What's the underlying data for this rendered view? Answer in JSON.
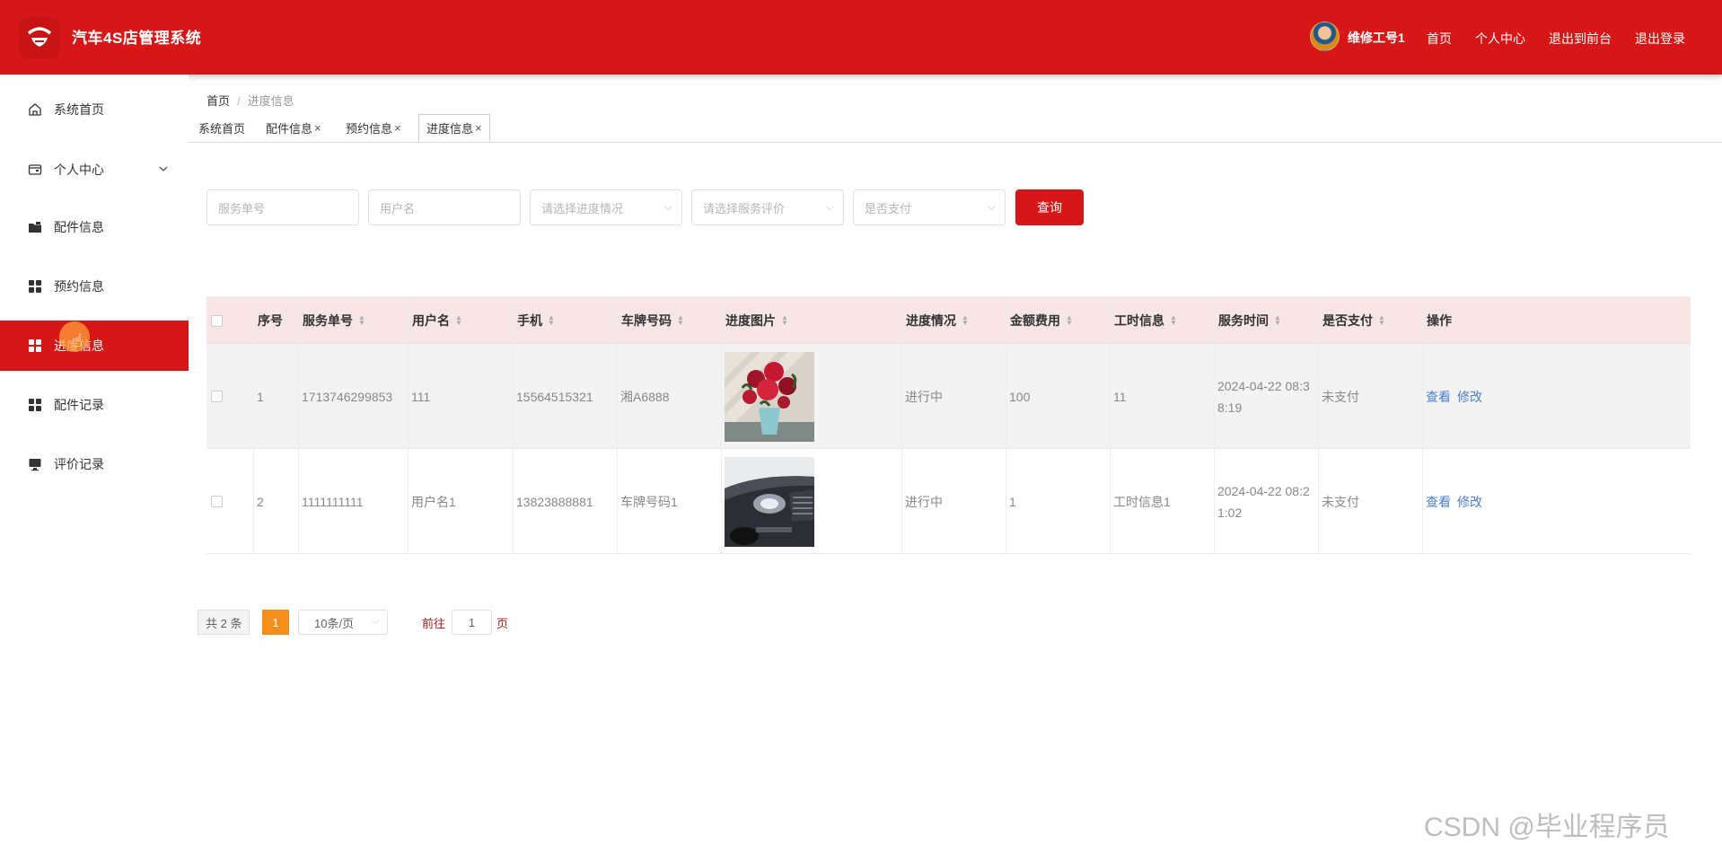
{
  "header": {
    "title": "汽车4S店管理系统",
    "user_name": "维修工号1",
    "links": [
      "首页",
      "个人中心",
      "退出到前台",
      "退出登录"
    ],
    "accent_color": "#d71717"
  },
  "sidebar": {
    "items": [
      {
        "label": "系统首页",
        "icon": "home-icon"
      },
      {
        "label": "个人中心",
        "icon": "wallet-icon"
      },
      {
        "label": "配件信息",
        "icon": "folder-icon"
      },
      {
        "label": "预约信息",
        "icon": "grid-icon"
      },
      {
        "label": "进度信息",
        "icon": "grid-icon",
        "active": true
      },
      {
        "label": "配件记录",
        "icon": "grid-icon"
      },
      {
        "label": "评价记录",
        "icon": "monitor-icon"
      }
    ]
  },
  "breadcrumb": {
    "home": "首页",
    "current": "进度信息"
  },
  "tabs": [
    {
      "label": "系统首页",
      "closable": false
    },
    {
      "label": "配件信息",
      "closable": true
    },
    {
      "label": "预约信息",
      "closable": true
    },
    {
      "label": "进度信息",
      "closable": true,
      "active": true
    }
  ],
  "filters": {
    "service_no_placeholder": "服务单号",
    "username_placeholder": "用户名",
    "progress_placeholder": "请选择进度情况",
    "rating_placeholder": "请选择服务评价",
    "paid_placeholder": "是否支付",
    "query_label": "查询"
  },
  "table": {
    "columns": [
      "序号",
      "服务单号",
      "用户名",
      "手机",
      "车牌号码",
      "进度图片",
      "进度情况",
      "金额费用",
      "工时信息",
      "服务时间",
      "是否支付",
      "操作"
    ],
    "rows": [
      {
        "index": "1",
        "service_no": "1713746299853",
        "username": "111",
        "phone": "15564515321",
        "plate": "湘A6888",
        "image": "flowers-photo",
        "progress": "进行中",
        "amount": "100",
        "hours": "11",
        "time": "2024-04-22 08:3\n8:19",
        "paid": "未支付",
        "actions": [
          "查看",
          "修改"
        ]
      },
      {
        "index": "2",
        "service_no": "1111111111",
        "username": "用户名1",
        "phone": "13823888881",
        "plate": "车牌号码1",
        "image": "car-photo",
        "progress": "进行中",
        "amount": "1",
        "hours": "工时信息1",
        "time": "2024-04-22 08:2\n1:02",
        "paid": "未支付",
        "actions": [
          "查看",
          "修改"
        ]
      }
    ]
  },
  "pagination": {
    "total": "共 2 条",
    "current_page": "1",
    "page_size": "10条/页",
    "goto_label": "前往",
    "goto_value": "1",
    "page_unit": "页"
  },
  "watermark": "CSDN @毕业程序员"
}
